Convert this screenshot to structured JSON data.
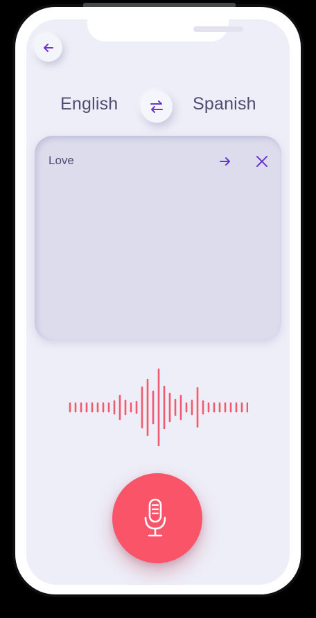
{
  "header": {
    "back_icon": "arrow-left-icon"
  },
  "languages": {
    "source": "English",
    "target": "Spanish",
    "swap_icon": "swap-arrows-icon"
  },
  "input": {
    "text": "Love",
    "translate_icon": "arrow-right-icon",
    "clear_icon": "close-icon"
  },
  "voice": {
    "waveform_icon": "sound-wave",
    "mic_icon": "microphone-icon"
  },
  "colors": {
    "accent": "#6a35d0",
    "mic": "#f95468",
    "wave": "#f05a6e",
    "background": "#eeeef8",
    "text": "#4d4e72"
  }
}
